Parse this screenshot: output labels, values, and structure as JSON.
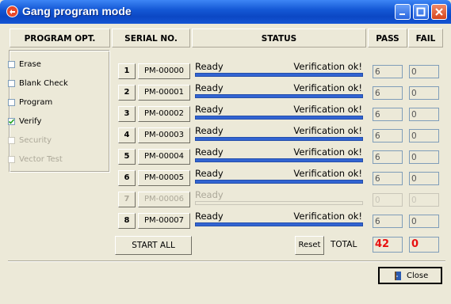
{
  "window": {
    "title": "Gang program mode"
  },
  "headers": {
    "program_opt": "PROGRAM OPT.",
    "serial_no": "SERIAL NO.",
    "status": "STATUS",
    "pass": "PASS",
    "fail": "FAIL"
  },
  "options": [
    {
      "label": "Erase",
      "checked": false,
      "enabled": true
    },
    {
      "label": "Blank Check",
      "checked": false,
      "enabled": true
    },
    {
      "label": "Program",
      "checked": false,
      "enabled": true
    },
    {
      "label": "Verify",
      "checked": true,
      "enabled": true
    },
    {
      "label": "Security",
      "checked": false,
      "enabled": false
    },
    {
      "label": "Vector Test",
      "checked": false,
      "enabled": false
    }
  ],
  "rows": [
    {
      "num": "1",
      "serial": "PM-00000",
      "state": "Ready",
      "result": "Verification ok!",
      "pass": "6",
      "fail": "0",
      "enabled": true
    },
    {
      "num": "2",
      "serial": "PM-00001",
      "state": "Ready",
      "result": "Verification ok!",
      "pass": "6",
      "fail": "0",
      "enabled": true
    },
    {
      "num": "3",
      "serial": "PM-00002",
      "state": "Ready",
      "result": "Verification ok!",
      "pass": "6",
      "fail": "0",
      "enabled": true
    },
    {
      "num": "4",
      "serial": "PM-00003",
      "state": "Ready",
      "result": "Verification ok!",
      "pass": "6",
      "fail": "0",
      "enabled": true
    },
    {
      "num": "5",
      "serial": "PM-00004",
      "state": "Ready",
      "result": "Verification ok!",
      "pass": "6",
      "fail": "0",
      "enabled": true
    },
    {
      "num": "6",
      "serial": "PM-00005",
      "state": "Ready",
      "result": "Verification ok!",
      "pass": "6",
      "fail": "0",
      "enabled": true
    },
    {
      "num": "7",
      "serial": "PM-00006",
      "state": "Ready",
      "result": "",
      "pass": "0",
      "fail": "0",
      "enabled": false
    },
    {
      "num": "8",
      "serial": "PM-00007",
      "state": "Ready",
      "result": "Verification ok!",
      "pass": "6",
      "fail": "0",
      "enabled": true
    }
  ],
  "footer": {
    "start_all": "START ALL",
    "reset": "Reset",
    "total_label": "TOTAL",
    "total_pass": "42",
    "total_fail": "0",
    "close": "Close"
  },
  "colors": {
    "progress": "#3264d2",
    "total_value": "#e81010",
    "titlebar": "#0b47c4"
  }
}
